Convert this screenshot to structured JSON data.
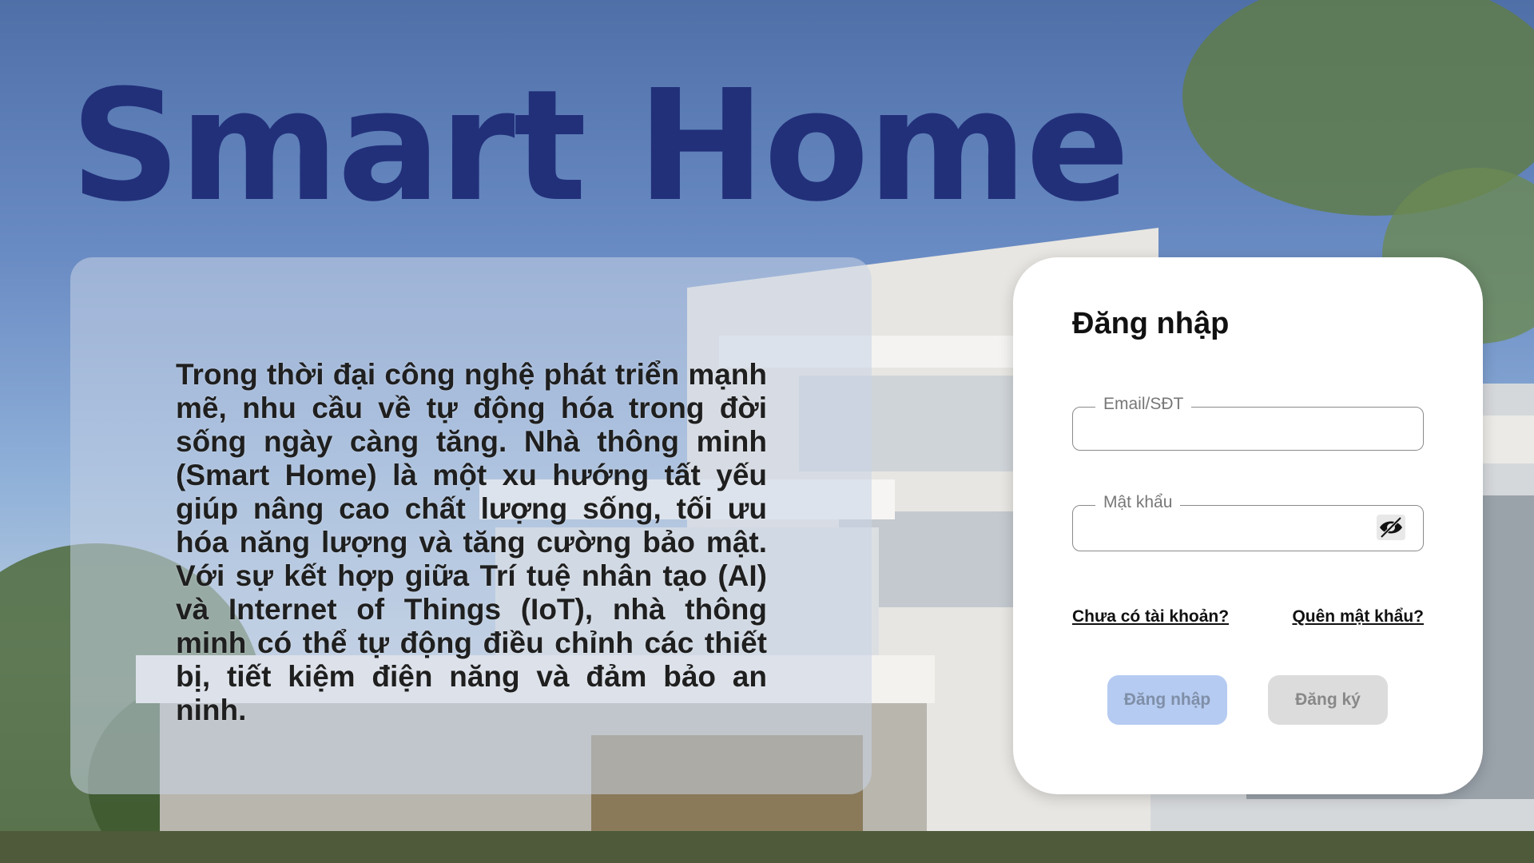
{
  "page": {
    "title": "Smart Home",
    "intro": "Trong thời đại công nghệ phát triển mạnh mẽ, nhu cầu về tự động hóa trong đời sống ngày càng tăng. Nhà thông minh (Smart Home) là một xu hướng tất yếu giúp nâng cao chất lượng sống, tối ưu hóa năng lượng và tăng cường bảo mật. Với sự kết hợp giữa Trí tuệ nhân tạo (AI) và Internet of Things (IoT), nhà thông minh có thể tự động điều chỉnh các thiết bị, tiết kiệm điện năng và đảm bảo an ninh."
  },
  "login": {
    "heading": "Đăng nhập",
    "email_label": "Email/SĐT",
    "email_value": "",
    "password_label": "Mật khẩu",
    "password_value": "",
    "password_icon": "eye-slash-icon",
    "no_account_link": "Chưa có tài khoản?",
    "forgot_password_link": "Quên mật khẩu?",
    "login_button": "Đăng nhập",
    "register_button": "Đăng ký"
  },
  "colors": {
    "title": "#22307a",
    "login_button_bg": "#b6cbf1",
    "register_button_bg": "#dcdcdc"
  }
}
